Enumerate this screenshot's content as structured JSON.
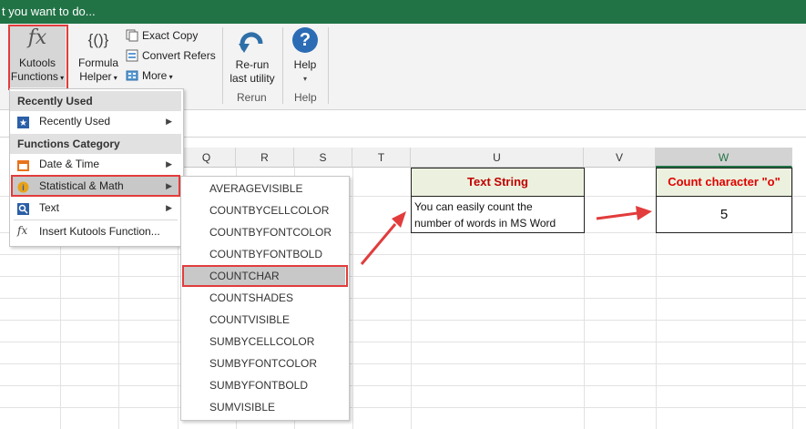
{
  "tell_me": "t you want to do...",
  "ribbon": {
    "kutools_functions": {
      "line1": "Kutools",
      "line2": "Functions",
      "icon_text": "fx"
    },
    "formula_helper": {
      "line1": "Formula",
      "line2": "Helper",
      "icon_text": "{()}"
    },
    "exact_copy": "Exact Copy",
    "convert_refers": "Convert Refers",
    "more": "More",
    "rerun": {
      "line1": "Re-run",
      "line2": "last utility"
    },
    "help": {
      "line1": "Help",
      "icon_text": "?"
    },
    "group_rerun": "Rerun",
    "group_help": "Help"
  },
  "columns": [
    "Q",
    "R",
    "S",
    "T",
    "U",
    "V",
    "W"
  ],
  "cells": {
    "u_header": "Text String",
    "w_header": "Count character \"o\"",
    "u_value_line1": "You can easily count the",
    "u_value_line2": "number of words in MS Word",
    "w_value": "5"
  },
  "menu": {
    "recently_used_head": "Recently Used",
    "recently_used_item": "Recently Used",
    "functions_category_head": "Functions Category",
    "date_time": "Date & Time",
    "stat_math": "Statistical & Math",
    "text": "Text",
    "insert_kutools": "Insert Kutools Function...",
    "insert_icon_text": "fx"
  },
  "submenu": [
    "AVERAGEVISIBLE",
    "COUNTBYCELLCOLOR",
    "COUNTBYFONTCOLOR",
    "COUNTBYFONTBOLD",
    "COUNTCHAR",
    "COUNTSHADES",
    "COUNTVISIBLE",
    "SUMBYCELLCOLOR",
    "SUMBYFONTCOLOR",
    "SUMBYFONTBOLD",
    "SUMVISIBLE"
  ],
  "colors": {
    "excel_green": "#217346",
    "highlight_red": "#e23c3c",
    "header_cell_bg": "#ebf1de",
    "red_text": "#c00000"
  }
}
